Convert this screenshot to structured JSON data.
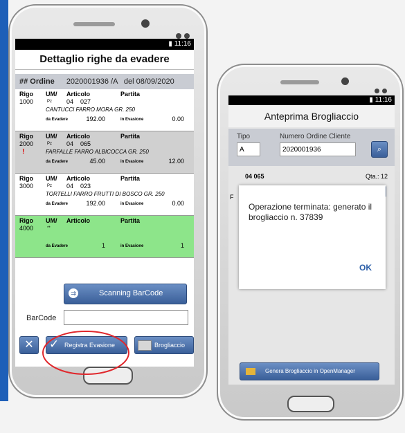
{
  "left": {
    "status_time": "11:16",
    "title": "Dettaglio righe da evadere",
    "order_label": "## Ordine",
    "order_number": "2020001936 /A",
    "order_date": "del 08/09/2020",
    "col_labels": {
      "rigo": "Rigo",
      "um": "UM/",
      "articolo": "Articolo",
      "partita": "Partita",
      "da_evadere": "da Evadere",
      "in_evasione": "in Evasione"
    },
    "rows": [
      {
        "rigo": "1000",
        "um": "Pz",
        "qty": "04",
        "code": "027",
        "desc": "CANTUCCI FARRO MORA GR. 250",
        "da": "192.00",
        "in": "0.00",
        "bg": "white",
        "mark": ""
      },
      {
        "rigo": "2000",
        "um": "Pz",
        "qty": "04",
        "code": "065",
        "desc": "FARFALLE FARRO ALBICOCCA GR. 250",
        "da": "45.00",
        "in": "12.00",
        "bg": "grey",
        "mark": "!"
      },
      {
        "rigo": "3000",
        "um": "Pz",
        "qty": "04",
        "code": "023",
        "desc": "TORTELLI FARRO FRUTTI DI BOSCO GR. 250",
        "da": "192.00",
        "in": "0.00",
        "bg": "white",
        "mark": ""
      },
      {
        "rigo": "4000",
        "um": "**",
        "qty": "",
        "code": "",
        "desc": "",
        "da": "1",
        "in": "1",
        "bg": "green",
        "mark": ""
      }
    ],
    "scan_button": "Scanning BarCode",
    "barcode_label": "BarCode",
    "barcode_value": "",
    "close_glyph": "✕",
    "register_button": "Registra Evasione",
    "check_glyph": "✓",
    "brogliaccio_button": "Brogliaccio",
    "annotation_color": "#e0282d"
  },
  "right": {
    "status_time": "11:16",
    "title": "Anteprima Brogliaccio",
    "tipo_label": "Tipo",
    "tipo_value": "A",
    "num_label": "Numero Ordine Cliente",
    "num_value": "2020001936",
    "search_icon": "search-icon",
    "item_code": "04 065",
    "qty_label": "Qta.: 12",
    "row_prefix": "F",
    "modal_message": "Operazione terminata: generato il brogliaccio n. 37839",
    "modal_ok": "OK",
    "generate_button": "Genera Brogliaccio in OpenManager"
  },
  "colors": {
    "accent": "#3a5f99",
    "green_row": "#8de58a",
    "blue_bar": "#1e5fb8"
  }
}
